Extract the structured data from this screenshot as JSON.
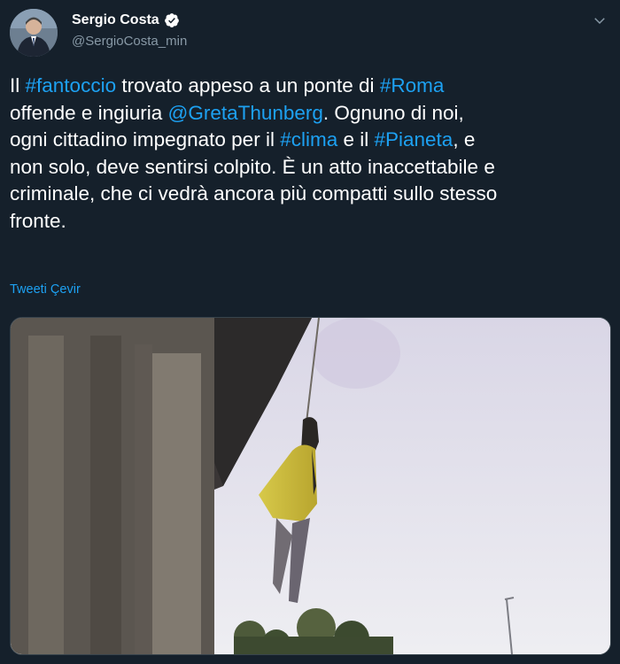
{
  "author": {
    "display_name": "Sergio Costa",
    "handle": "@SergioCosta_min",
    "verified": true,
    "avatar_icon": "profile-photo"
  },
  "tweet": {
    "segments": [
      {
        "text": "Il ",
        "type": "text"
      },
      {
        "text": "#fantoccio",
        "type": "hashtag"
      },
      {
        "text": " trovato appeso a un ponte di ",
        "type": "text"
      },
      {
        "text": "#Roma",
        "type": "hashtag"
      },
      {
        "text": "\n offende e ingiuria ",
        "type": "text"
      },
      {
        "text": "@GretaThunberg",
        "type": "mention"
      },
      {
        "text": ". Ognuno di noi,\nogni cittadino impegnato per il ",
        "type": "text"
      },
      {
        "text": "#clima",
        "type": "hashtag"
      },
      {
        "text": " e il ",
        "type": "text"
      },
      {
        "text": "#Pianeta",
        "type": "hashtag"
      },
      {
        "text": ", e\nnon solo, deve sentirsi colpito. È un atto inaccettabile e\ncriminale, che ci vedrà ancora più compatti sullo stesso\nfronte.",
        "type": "text"
      }
    ],
    "translate_label": "Tweeti Çevir"
  },
  "colors": {
    "background": "#15202b",
    "link": "#1da1f2",
    "secondary_text": "#8899a6",
    "verified": "#ffffff"
  },
  "icons": {
    "verified": "verified-badge-icon",
    "menu": "chevron-down-icon"
  }
}
